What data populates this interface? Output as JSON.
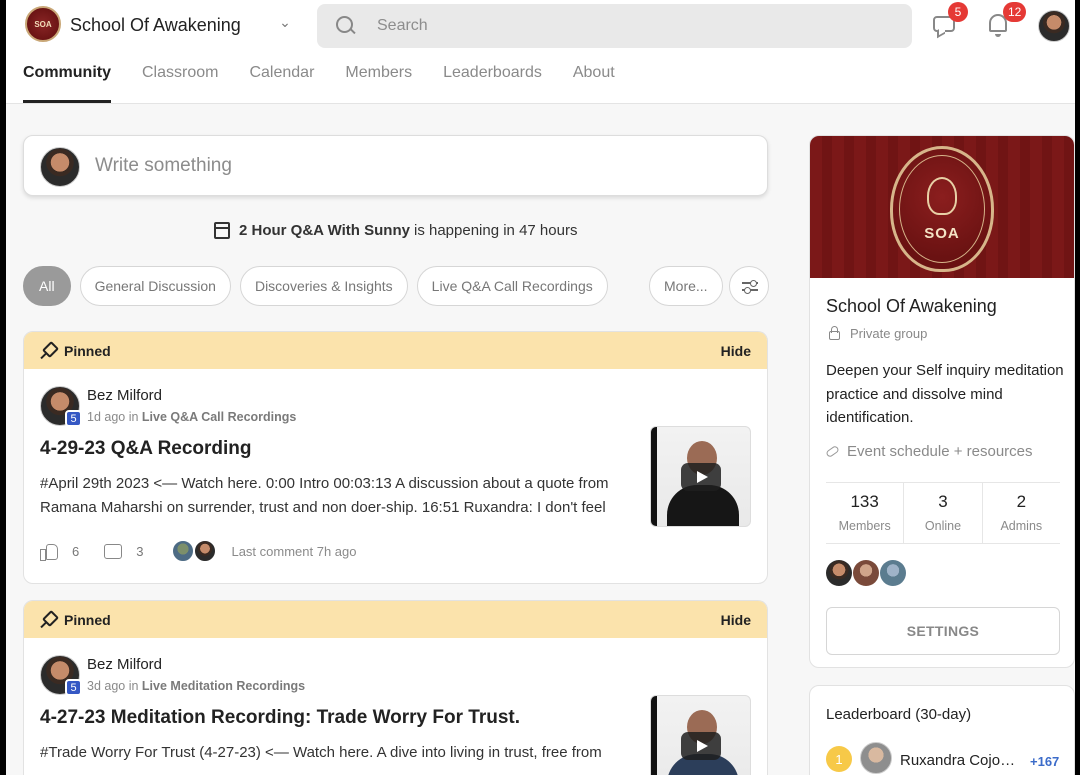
{
  "header": {
    "group_name": "School Of Awakening",
    "logo_text": "SOA",
    "search_placeholder": "Search",
    "chat_badge": "5",
    "notif_badge": "12",
    "tabs": [
      "Community",
      "Classroom",
      "Calendar",
      "Members",
      "Leaderboards",
      "About"
    ],
    "active_tab": "Community"
  },
  "composer": {
    "placeholder": "Write something"
  },
  "event": {
    "title": "2 Hour Q&A With Sunny",
    "suffix": "is happening in 47 hours"
  },
  "filters": {
    "chips": [
      "All",
      "General Discussion",
      "Discoveries & Insights",
      "Live Q&A Call Recordings"
    ],
    "more": "More..."
  },
  "posts": [
    {
      "pinned_label": "Pinned",
      "hide_label": "Hide",
      "author": "Bez Milford",
      "level": "5",
      "time": "1d ago in",
      "category": "Live Q&A Call Recordings",
      "title": "4-29-23 Q&A Recording",
      "body": "#April 29th 2023 <— Watch here. 0:00 Intro 00:03:13 A discussion about a quote from Ramana Maharshi on surrender, trust and non doer-ship. 16:51 Ruxandra: I don't feel",
      "likes": "6",
      "comments": "3",
      "last_comment": "Last comment 7h ago"
    },
    {
      "pinned_label": "Pinned",
      "hide_label": "Hide",
      "author": "Bez Milford",
      "level": "5",
      "time": "3d ago in",
      "category": "Live Meditation Recordings",
      "title": "4-27-23 Meditation Recording: Trade Worry For Trust.",
      "body": "#Trade Worry For Trust (4-27-23) <— Watch here. A dive into living in trust, free from"
    }
  ],
  "sidebar": {
    "cover_text": "SOA",
    "title": "School Of Awakening",
    "privacy": "Private group",
    "description": "Deepen your Self inquiry meditation practice and dissolve mind identification.",
    "resources_link": "Event schedule + resources",
    "stats": [
      {
        "value": "133",
        "label": "Members"
      },
      {
        "value": "3",
        "label": "Online"
      },
      {
        "value": "2",
        "label": "Admins"
      }
    ],
    "settings_label": "SETTINGS"
  },
  "leaderboard": {
    "title": "Leaderboard (30-day)",
    "rank": "1",
    "name": "Ruxandra Cojocaru",
    "points": "+167"
  },
  "colors": {
    "pinned_bar": "#fbe3ac",
    "badge_red": "#e53935",
    "level_blue": "#3558c4",
    "brand_maroon": "#7b1818"
  }
}
